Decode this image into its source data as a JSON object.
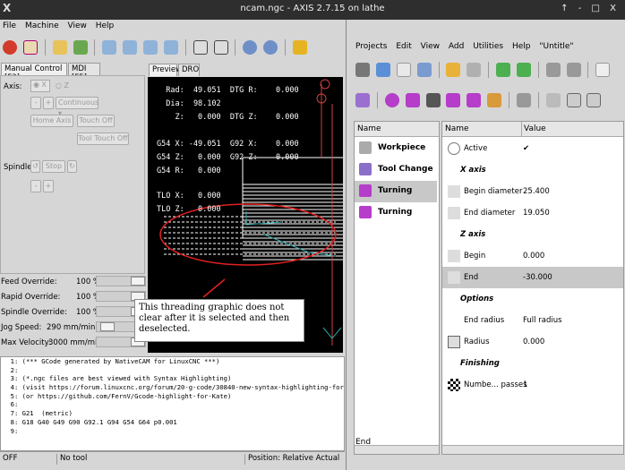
{
  "title_bar": {
    "icon": "X",
    "title": "ncam.ngc - AXIS 2.7.15 on lathe",
    "controls": "↑ - □ X"
  },
  "axis_menu": [
    "File",
    "Machine",
    "View",
    "Help"
  ],
  "left_tabs": [
    "Manual Control [F3]",
    "MDI [F5]"
  ],
  "manual": {
    "axis_label": "Axis:",
    "axis_options": [
      "X",
      "Z"
    ],
    "jog_mode": "Continuous",
    "home_axis": "Home Axis",
    "touch_off": "Touch Off",
    "tool_touch_off": "Tool Touch Off",
    "spindle_label": "Spindle:",
    "stop": "Stop"
  },
  "overrides": [
    {
      "label": "Feed Override:",
      "value": "100 %",
      "level": 1.0
    },
    {
      "label": "Rapid Override:",
      "value": "100 %",
      "level": 1.0
    },
    {
      "label": "Spindle Override:",
      "value": "100 %",
      "level": 1.0
    },
    {
      "label": "Jog Speed:",
      "value": "290 mm/min",
      "level": 0.1
    },
    {
      "label": "Max Velocity:",
      "value": "3000 mm/min",
      "level": 1.0
    }
  ],
  "preview_tabs": [
    "Preview",
    "DRO"
  ],
  "dro": [
    "  Rad:  49.051  DTG R:    0.000",
    "  Dia:  98.102",
    "    Z:   0.000  DTG Z:    0.000",
    "",
    "G54 X: -49.051  G92 X:    0.000",
    "G54 Z:   0.000  G92 Z:    0.000",
    "G54 R:   0.000",
    "",
    "",
    "TLO X:   0.000",
    "TLO Z:   0.000"
  ],
  "annotation": "This threading graphic does not clear after it is selected and then deselected.",
  "gcode_lines": [
    "  1: (*** GCode generated by NativeCAM for LinuxCNC ***)",
    "  2:",
    "  3: (*.ngc files are best viewed with Syntax Highlighting)",
    "  4: (visit https://forum.linuxcnc.org/forum/20-g-code/30840-new-syntax-highlighting-for-gedit)",
    "  5: (or https://github.com/FernV/Gcode-highlight-for-Kate)",
    "  6:",
    "  7: G21  (metric)",
    "  8: G18 G40 G49 G90 G92.1 G94 G54 G64 p0.001",
    "  9:"
  ],
  "status_bar": [
    "OFF",
    "No tool",
    "Position: Relative Actual"
  ],
  "ncam_menu": [
    "Projects",
    "Edit",
    "View",
    "Add",
    "Utilities",
    "Help",
    "\"Untitle\""
  ],
  "tree": {
    "header": "Name",
    "items": [
      {
        "label": "Workpiece",
        "icon": "box-icon",
        "color": "#aaaaaa"
      },
      {
        "label": "Tool Change",
        "icon": "tool-change-icon",
        "color": "#8a6fc9"
      },
      {
        "label": "Turning",
        "icon": "turning-icon",
        "color": "#b53dc9"
      },
      {
        "label": "Turning",
        "icon": "turning-icon",
        "color": "#b53dc9"
      }
    ]
  },
  "props": {
    "header_name": "Name",
    "header_value": "Value",
    "rows": [
      {
        "name": "Active",
        "value": "✔",
        "type": "row",
        "icon": "power-icon"
      },
      {
        "name": "X axis",
        "value": "",
        "type": "sec"
      },
      {
        "name": "Begin diameter",
        "value": "25.400",
        "type": "row",
        "icon": "x-begin-icon"
      },
      {
        "name": "End diameter",
        "value": "19.050",
        "type": "row",
        "icon": "x-end-icon"
      },
      {
        "name": "Z axis",
        "value": "",
        "type": "sec"
      },
      {
        "name": "Begin",
        "value": "0.000",
        "type": "row",
        "icon": "z-begin-icon"
      },
      {
        "name": "End",
        "value": "-30.000",
        "type": "row",
        "icon": "z-end-icon"
      },
      {
        "name": "Options",
        "value": "",
        "type": "sec"
      },
      {
        "name": "End radius",
        "value": "Full radius",
        "type": "row",
        "icon": ""
      },
      {
        "name": "Radius",
        "value": "0.000",
        "type": "row",
        "icon": "radius-icon"
      },
      {
        "name": "Finishing",
        "value": "",
        "type": "sec"
      },
      {
        "name": "Numbe... passes",
        "value": "1",
        "type": "row",
        "icon": "checker-icon"
      }
    ]
  },
  "ncam_status": "End",
  "colors": {
    "selected_row": "#c8c8c8",
    "annotation_ellipse": "#e02020",
    "preview_bg": "#000000"
  }
}
